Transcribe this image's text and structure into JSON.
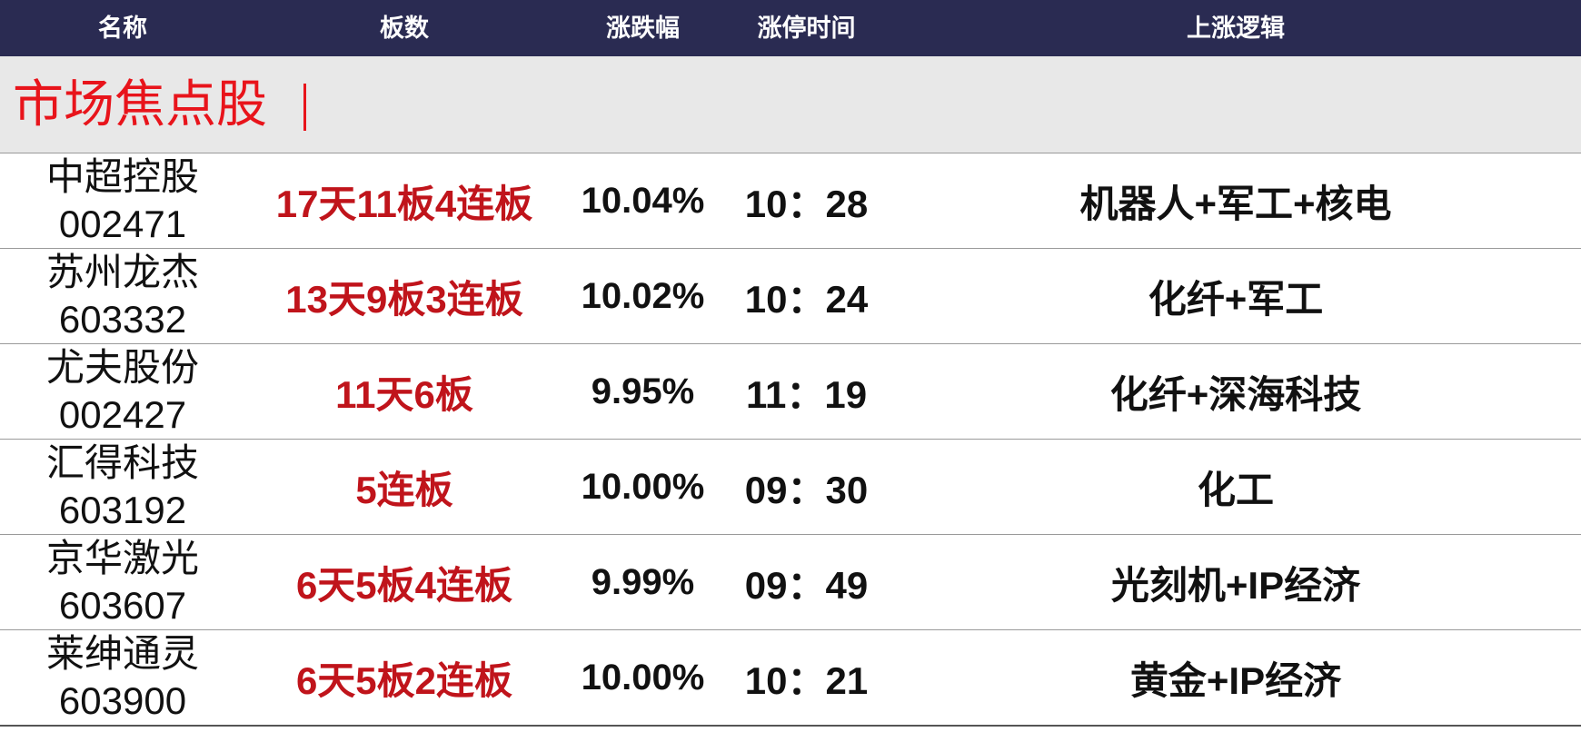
{
  "header": {
    "name": "名称",
    "boards": "板数",
    "change": "涨跌幅",
    "limit_time": "涨停时间",
    "logic": "上涨逻辑"
  },
  "section": {
    "title": "市场焦点股",
    "accent_color": "#e8141b"
  },
  "colors": {
    "header_bg": "#2a2b52",
    "section_bg": "#e8e8e8",
    "board_text": "#c0141b"
  },
  "rows": [
    {
      "name": "中超控股",
      "code": "002471",
      "boards": "17天11板4连板",
      "change": "10.04%",
      "time": "10：28",
      "logic": "机器人+军工+核电"
    },
    {
      "name": "苏州龙杰",
      "code": "603332",
      "boards": "13天9板3连板",
      "change": "10.02%",
      "time": "10：24",
      "logic": "化纤+军工"
    },
    {
      "name": "尤夫股份",
      "code": "002427",
      "boards": "11天6板",
      "change": "9.95%",
      "time": "11：19",
      "logic": "化纤+深海科技"
    },
    {
      "name": "汇得科技",
      "code": "603192",
      "boards": "5连板",
      "change": "10.00%",
      "time": "09：30",
      "logic": "化工"
    },
    {
      "name": "京华激光",
      "code": "603607",
      "boards": "6天5板4连板",
      "change": "9.99%",
      "time": "09：49",
      "logic": "光刻机+IP经济"
    },
    {
      "name": "莱绅通灵",
      "code": "603900",
      "boards": "6天5板2连板",
      "change": "10.00%",
      "time": "10：21",
      "logic": "黄金+IP经济"
    }
  ]
}
